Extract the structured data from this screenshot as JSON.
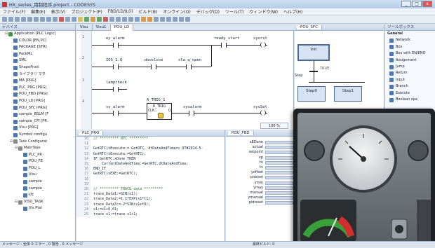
{
  "window": {
    "title": "HX_series_用制程序.project - CODESYS",
    "btn_min": "_",
    "btn_max": "□",
    "btn_close": "x"
  },
  "menu": [
    "ファイル(F)",
    "編集(E)",
    "表示(V)",
    "プロジェクト(P)",
    "FBD/LD/IL(I)",
    "ビルド(B)",
    "オンライン(O)",
    "デバッグ(D)",
    "ツール(T)",
    "ウィンドウ(W)",
    "ヘルプ(H)"
  ],
  "devices": {
    "header": "デバイス",
    "items": [
      {
        "label": "Application [PLC Logic]",
        "indent": 1,
        "kind": "app"
      },
      {
        "label": "COLOR [EN,PC]",
        "indent": 2,
        "kind": "pou"
      },
      {
        "label": "PACKAGE [STR]",
        "indent": 2,
        "kind": "pou"
      },
      {
        "label": "PackML",
        "indent": 2,
        "kind": "pou"
      },
      {
        "label": "SML",
        "indent": 2,
        "kind": "pou"
      },
      {
        "label": "ShapeFrool",
        "indent": 2,
        "kind": "pou"
      },
      {
        "label": "ライブラリ マネ",
        "indent": 2,
        "kind": "pou"
      },
      {
        "label": "MA [PRG]",
        "indent": 2,
        "kind": "pou"
      },
      {
        "label": "PLC_PRG [PRG]",
        "indent": 2,
        "kind": "pou"
      },
      {
        "label": "POU_FBD [PRG]",
        "indent": 2,
        "kind": "pou"
      },
      {
        "label": "POU_LD [PRG]",
        "indent": 2,
        "kind": "pou"
      },
      {
        "label": "POU_SFC [PRG]",
        "indent": 2,
        "kind": "pou"
      },
      {
        "label": "sample_BSLM [F",
        "indent": 2,
        "kind": "pou"
      },
      {
        "label": "sample_CFI [PR",
        "indent": 2,
        "kind": "pou"
      },
      {
        "label": "Visu [PRG]",
        "indent": 2,
        "kind": "pou"
      },
      {
        "label": "Symbol configu",
        "indent": 2,
        "kind": "pou"
      },
      {
        "label": "Task Configurat",
        "indent": 2,
        "kind": "task"
      },
      {
        "label": "MainTask",
        "indent": 3,
        "kind": "task"
      },
      {
        "label": "PLC_PR",
        "indent": 4,
        "kind": "pou"
      },
      {
        "label": "POU_FE",
        "indent": 4,
        "kind": "pou"
      },
      {
        "label": "POU_L",
        "indent": 4,
        "kind": "pou"
      },
      {
        "label": "Visu",
        "indent": 4,
        "kind": "pou"
      },
      {
        "label": "sample",
        "indent": 4,
        "kind": "pou"
      },
      {
        "label": "sample_",
        "indent": 4,
        "kind": "pou"
      },
      {
        "label": "sfc",
        "indent": 4,
        "kind": "pou"
      },
      {
        "label": "VISU_TASK",
        "indent": 3,
        "kind": "task"
      },
      {
        "label": "Vis.Plat",
        "indent": 4,
        "kind": "pou"
      }
    ]
  },
  "ladder": {
    "tabs": [
      "Visu",
      "Visu1",
      "POU_LD"
    ],
    "rungs": [
      {
        "left": "ey_alarm",
        "mid": "ready_start",
        "right": "sysrst"
      },
      {
        "left": "IOS_1.Q",
        "mid": "dooclose",
        "mid2": "slw_q_open"
      },
      {
        "left": "lampcheck"
      },
      {
        "left": "sy_alarm",
        "mid": "A_TRIG_1",
        "fb": "R_TRIG",
        "fbin": "CLK",
        "fbout": "Q",
        "right": "sysalarm",
        "right2": "sysSet"
      }
    ],
    "zoom": "100 %"
  },
  "sfc": {
    "tab": "POU_SFC",
    "init": "Init",
    "trans": "TRUE",
    "step0": "Step0",
    "step1": "Step1",
    "label2": "Step"
  },
  "toolbox": {
    "header": "ツールボックス",
    "group": "General",
    "items": [
      "Network",
      "Box",
      "Box with EN/ENO",
      "Assignment",
      "Jump",
      "Return",
      "Input",
      "Branch",
      "Execute",
      "Boolean ope"
    ]
  },
  "plc": {
    "tab": "PLC_PRG",
    "lines": [
      {
        "no": "10",
        "text": "// ********* RTC *********",
        "c": true
      },
      {
        "no": "11",
        "text": ""
      },
      {
        "no": "12",
        "text": "GetRTC(xExecute:= GetRTC, dtDateAndTime=> DT#2014-5-"
      },
      {
        "no": "13",
        "text": "GetRTC(xExecute:=GetRTC);"
      },
      {
        "no": "14",
        "text": "IF GetRTC.xDone THEN"
      },
      {
        "no": "15",
        "text": "    CurrentDateAndTime:=GetRTC.dtDateAndTime;"
      },
      {
        "no": "16",
        "text": "END_IF"
      },
      {
        "no": "17",
        "text": "GetRTC(xEXE:=GetRTC);"
      },
      {
        "no": "18",
        "text": ""
      },
      {
        "no": "19",
        "text": ""
      },
      {
        "no": "20",
        "text": "// ********* TRACE data *********",
        "c": true
      },
      {
        "no": "21",
        "text": "trace_Data1:=SIN(x1);"
      },
      {
        "no": "22",
        "text": "trace_Data2:=1.1*EXP(x1*t1);"
      },
      {
        "no": "23",
        "text": "trace_Data3:=-2*SIN(x1+t0);"
      },
      {
        "no": "24",
        "text": "x1:=x1+0.01;"
      },
      {
        "no": "25",
        "text": "trace_x1:=trace x1+1;"
      }
    ]
  },
  "pou": {
    "tab": "POU_FBD",
    "vars": [
      "xEDone",
      "actual",
      "setpoint",
      "xp",
      "tn",
      "tv",
      "yoffset",
      "pidsset",
      "ymin",
      "ymax",
      "manual",
      "ymanual",
      "pidreset"
    ]
  },
  "hmi": {
    "title": "HMI panel"
  },
  "statusbar": {
    "text": "メッセージ - 全体 0 エラー , 0 警告 , 0 メッセージ",
    "right": "最終ビルド: 0"
  }
}
